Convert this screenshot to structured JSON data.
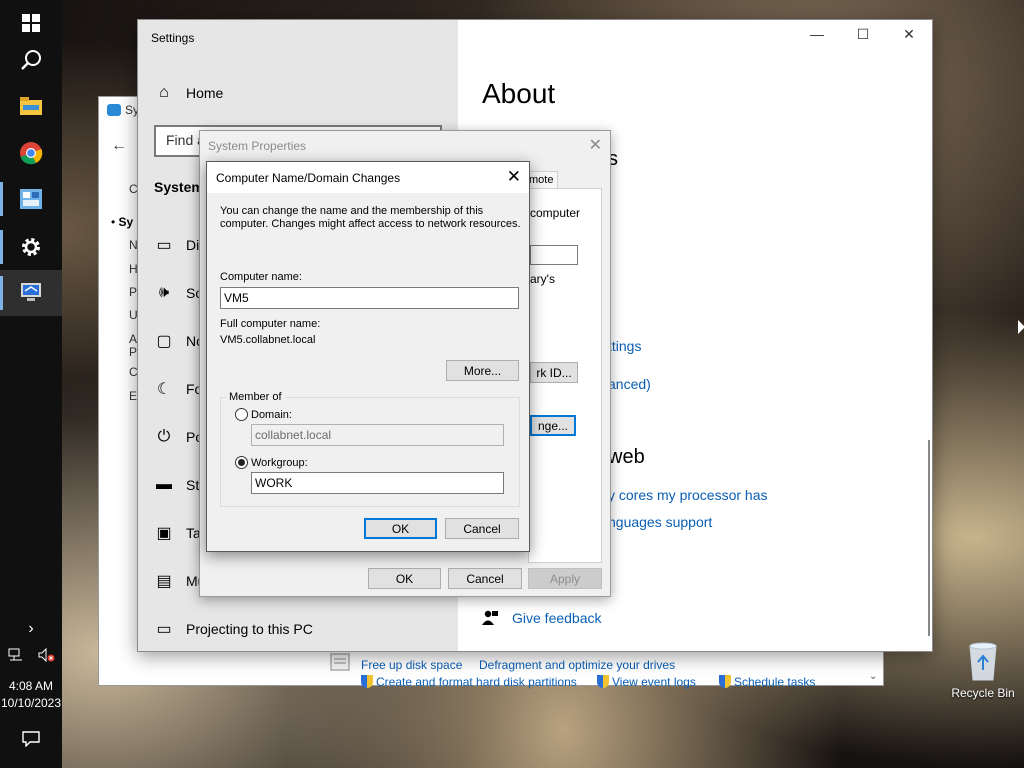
{
  "taskbar": {
    "time": "4:08 AM",
    "date": "10/10/2023"
  },
  "control_panel": {
    "title": "Sy",
    "links": {
      "free_disk": "Free up disk space",
      "defrag": "Defragment and optimize your drives",
      "partitions": "Create and format hard disk partitions",
      "event_logs": "View event logs",
      "schedule": "Schedule tasks"
    },
    "sidebar_fragments": [
      "C",
      "Sy",
      "N",
      "H",
      "Pr",
      "U",
      "A",
      "P",
      "C",
      "Ea"
    ]
  },
  "settings": {
    "title": "Settings",
    "nav": {
      "home": "Home",
      "search_placeholder": "Find a",
      "section": "System",
      "display": "Dis",
      "sound": "So",
      "notifications": "No",
      "focus": "Fo",
      "power": "Po",
      "storage": "Sto",
      "tablet": "Ta",
      "multitasking": "Mu",
      "projecting": "Projecting to this PC"
    },
    "about": {
      "title": "About",
      "heading_fragment": "s",
      "link1": "ttings",
      "link2": "anced)",
      "web_heading": "web",
      "web_link1": "y cores my processor has",
      "web_link2": "nguages support",
      "feedback": "Give feedback"
    }
  },
  "system_properties": {
    "title": "System Properties",
    "tab_fragment": "mote",
    "text1": "computer",
    "text2": "ary's",
    "network_id_btn": "rk ID...",
    "change_btn": "nge...",
    "ok": "OK",
    "cancel": "Cancel",
    "apply": "Apply"
  },
  "dialog": {
    "title": "Computer Name/Domain Changes",
    "desc_line1": "You can change the name and the membership of this",
    "desc_line2": "computer. Changes might affect access to network resources.",
    "computer_name_label": "Computer name:",
    "computer_name_value": "VM5",
    "full_name_label": "Full computer name:",
    "full_name_value": "VM5.collabnet.local",
    "more_btn": "More...",
    "member_of": "Member of",
    "domain_label": "Domain:",
    "domain_value": "collabnet.local",
    "workgroup_label": "Workgroup:",
    "workgroup_value": "WORK",
    "ok": "OK",
    "cancel": "Cancel"
  },
  "desktop": {
    "recycle_bin": "Recycle Bin"
  }
}
